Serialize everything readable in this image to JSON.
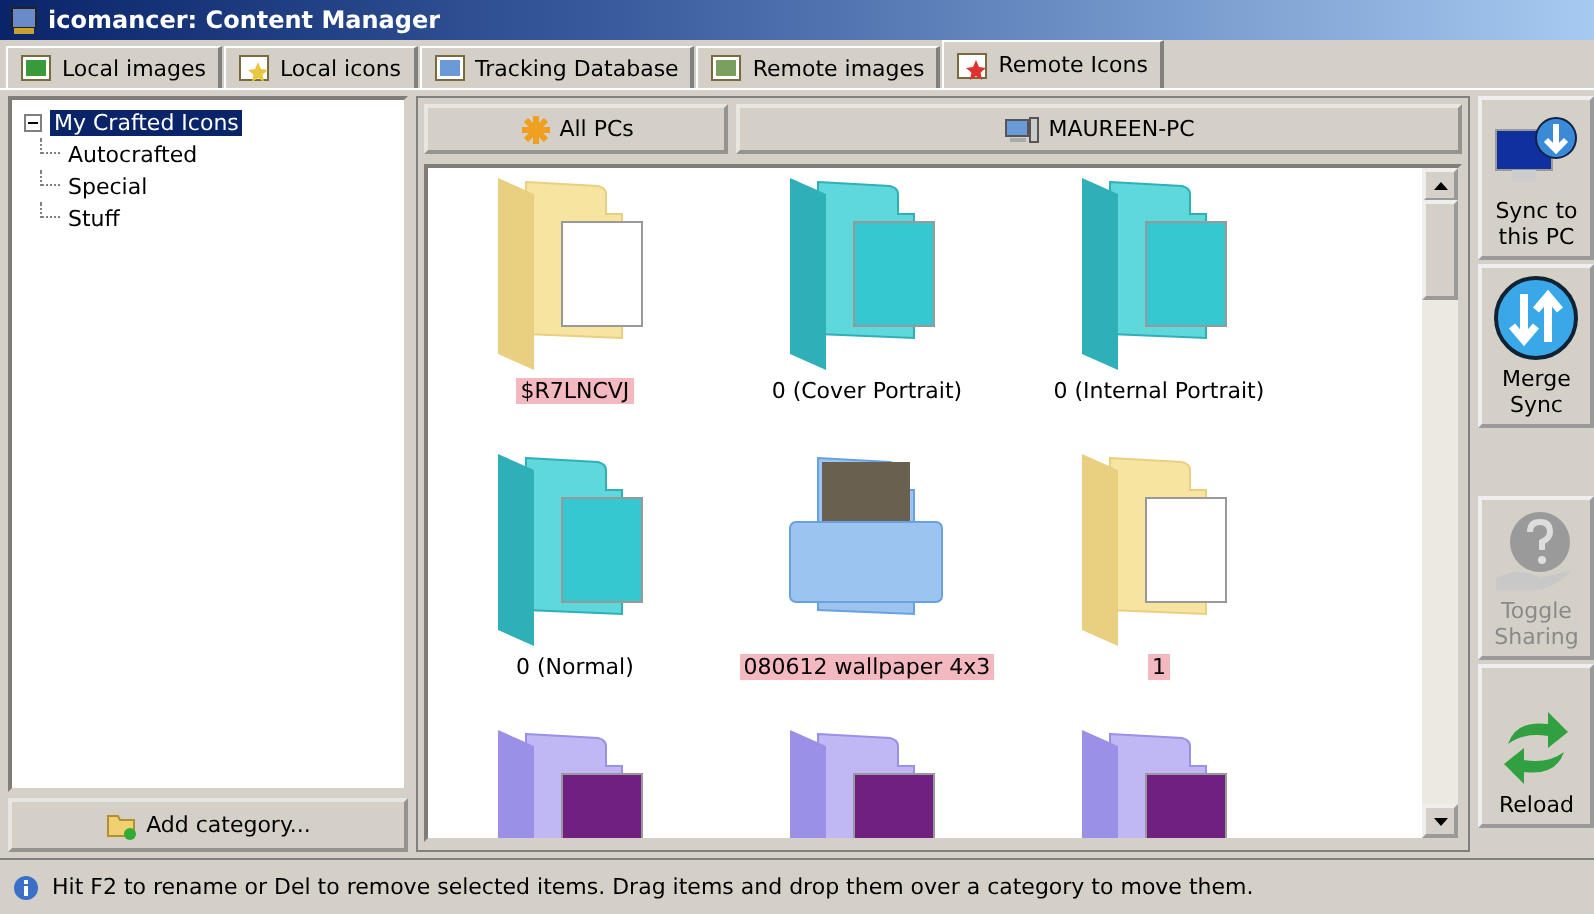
{
  "window": {
    "title": "icomancer: Content Manager"
  },
  "tabs": [
    {
      "label": "Local images",
      "selected": false,
      "kind": "image"
    },
    {
      "label": "Local icons",
      "selected": false,
      "kind": "icons"
    },
    {
      "label": "Tracking Database",
      "selected": false,
      "kind": "database"
    },
    {
      "label": "Remote images",
      "selected": false,
      "kind": "remote-image"
    },
    {
      "label": "Remote Icons",
      "selected": true,
      "kind": "remote-icons"
    }
  ],
  "tree": {
    "label": "My Crafted Icons",
    "selected": true,
    "expanded": true,
    "children": [
      {
        "label": "Autocrafted",
        "selected": false
      },
      {
        "label": "Special",
        "selected": false
      },
      {
        "label": "Stuff",
        "selected": false
      }
    ]
  },
  "add_category_button": "Add category...",
  "pc_buttons": [
    {
      "label": "All PCs",
      "kind": "all"
    },
    {
      "label": "MAUREEN-PC",
      "kind": "pc"
    }
  ],
  "items": [
    {
      "label": "$R7LNCVJ",
      "highlighted": true,
      "kind": "yellow"
    },
    {
      "label": "0 (Cover Portrait)",
      "highlighted": false,
      "kind": "teal"
    },
    {
      "label": "0 (Internal Portrait)",
      "highlighted": false,
      "kind": "teal"
    },
    {
      "label": "0 (Normal)",
      "highlighted": false,
      "kind": "teal"
    },
    {
      "label": "080612 wallpaper 4x3",
      "highlighted": true,
      "kind": "blue"
    },
    {
      "label": "1",
      "highlighted": true,
      "kind": "yellow"
    },
    {
      "kind": "purple"
    },
    {
      "kind": "purple"
    },
    {
      "kind": "purple"
    }
  ],
  "actions": [
    {
      "label": "Sync to this PC",
      "kind": "sync",
      "disabled": false
    },
    {
      "label": "Merge Sync",
      "kind": "merge",
      "disabled": false
    },
    {
      "kind": "spacer"
    },
    {
      "label": "Toggle Sharing",
      "kind": "share",
      "disabled": true
    },
    {
      "label": "Reload",
      "kind": "reload",
      "disabled": false
    }
  ],
  "status": "Hit F2 to rename or Del to remove selected items. Drag items and drop them over a category to move them."
}
